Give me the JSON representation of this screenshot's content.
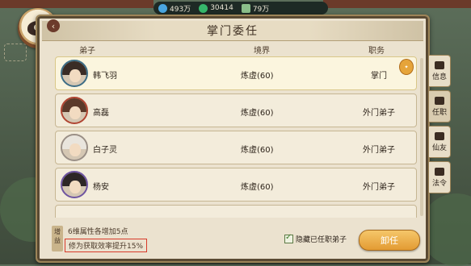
{
  "resources": [
    {
      "icon": "water-drop-icon",
      "value": "493万",
      "color": "#4aa6e0"
    },
    {
      "icon": "spirit-stone-icon",
      "value": "30414",
      "color": "#36b86b"
    },
    {
      "icon": "scroll-icon",
      "value": "79万",
      "color": "#8bbf8a"
    }
  ],
  "panel": {
    "title": "掌门委任",
    "close_glyph": "✕"
  },
  "columns": {
    "disciple": "弟子",
    "realm": "境界",
    "post": "职务"
  },
  "rows": [
    {
      "name": "韩飞羽",
      "realm": "炼虚(60)",
      "post": "掌门",
      "hair": "#3a2c26",
      "ring": "#3d6d86"
    },
    {
      "name": "高磊",
      "realm": "炼虚(60)",
      "post": "外门弟子",
      "hair": "#5b3a2a",
      "ring": "#b04532"
    },
    {
      "name": "白子灵",
      "realm": "炼虚(60)",
      "post": "外门弟子",
      "hair": "#e9e5dd",
      "ring": "#9a8f86"
    },
    {
      "name": "杨安",
      "realm": "炼虚(60)",
      "post": "外门弟子",
      "hair": "#2d2626",
      "ring": "#6e54a1"
    }
  ],
  "bottom": {
    "tag": "增益",
    "buff1": "6维属性各增加5点",
    "buff2": "修为获取效率提升15%",
    "checkbox_label": "隐藏已任职弟子",
    "button": "卸任"
  },
  "tabs": [
    {
      "label": "信息",
      "icon": "book-icon"
    },
    {
      "label": "任职",
      "icon": "seal-icon"
    },
    {
      "label": "仙友",
      "icon": "friends-icon"
    },
    {
      "label": "法令",
      "icon": "decree-icon"
    }
  ]
}
